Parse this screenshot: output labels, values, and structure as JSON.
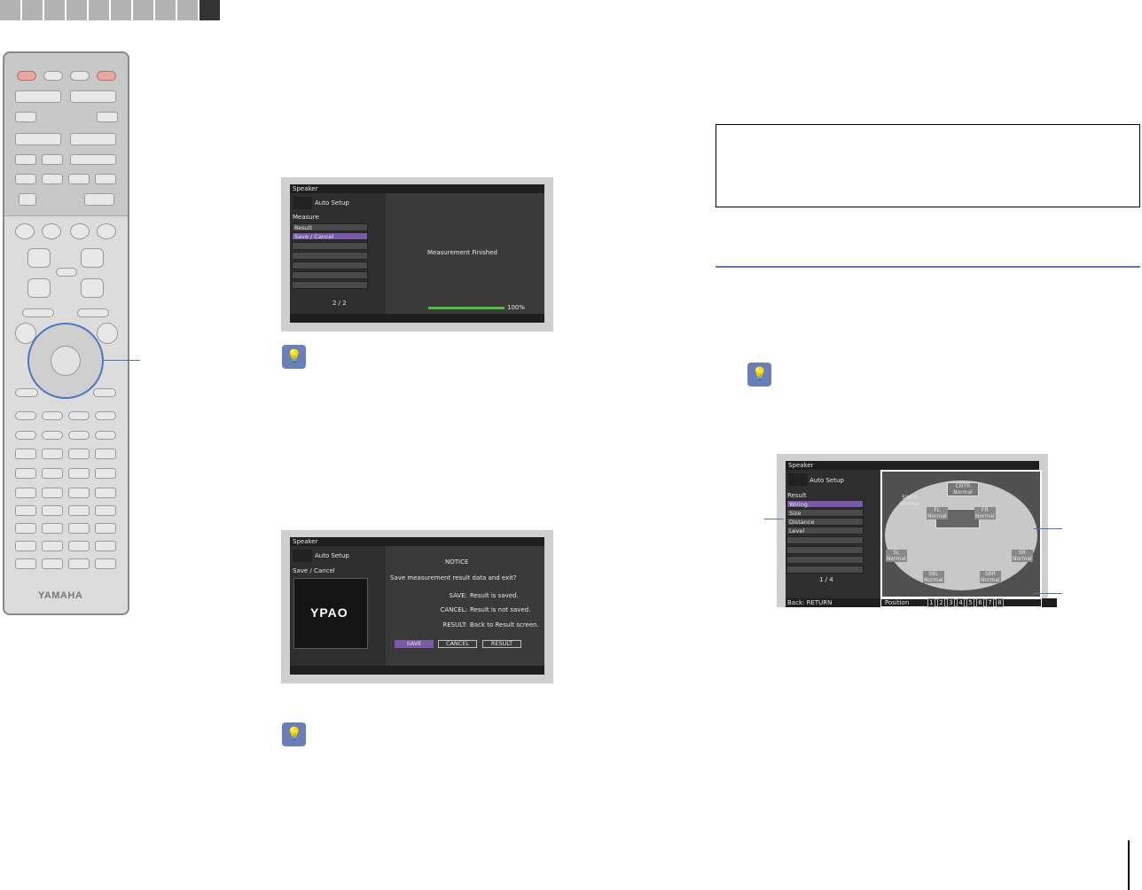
{
  "page_tabs": {
    "count": 10,
    "active_index": 9
  },
  "remote": {
    "brand": "YAMAHA"
  },
  "screen_measure": {
    "title": "Speaker",
    "header": "Auto Setup",
    "section": "Measure",
    "menu": [
      "Result",
      "Save / Cancel"
    ],
    "page": "2 / 2",
    "message": "Measurement Finished",
    "progress_label": "100%",
    "progress": 1.0
  },
  "screen_save": {
    "title": "Speaker",
    "header": "Auto Setup",
    "section": "Save / Cancel",
    "logo": "YPAO",
    "notice_title": "NOTICE",
    "question": "Save measurement result data and exit?",
    "lines": [
      {
        "key": "SAVE:",
        "text": "Result is saved."
      },
      {
        "key": "CANCEL:",
        "text": "Result is not saved."
      },
      {
        "key": "RESULT:",
        "text": "Back to Result screen."
      }
    ],
    "buttons": [
      "SAVE",
      "CANCEL",
      "RESULT"
    ]
  },
  "screen_result": {
    "title": "Speaker",
    "header": "Auto Setup",
    "section": "Result",
    "menu": [
      "Wiring",
      "Size",
      "Distance",
      "Level"
    ],
    "page": "1 / 4",
    "back": "Back: RETURN",
    "position_label": "Position",
    "positions": [
      "1",
      "2",
      "3",
      "4",
      "5",
      "6",
      "7",
      "8"
    ],
    "speakers": [
      {
        "id": "CNTR",
        "state": "Normal"
      },
      {
        "id": "SWFR",
        "state": "Normal"
      },
      {
        "id": "FL",
        "state": "Normal"
      },
      {
        "id": "FR",
        "state": "Normal"
      },
      {
        "id": "SL",
        "state": "Normal"
      },
      {
        "id": "SR",
        "state": "Normal"
      },
      {
        "id": "SBL",
        "state": "Normal"
      },
      {
        "id": "SBR",
        "state": "Normal"
      }
    ]
  }
}
